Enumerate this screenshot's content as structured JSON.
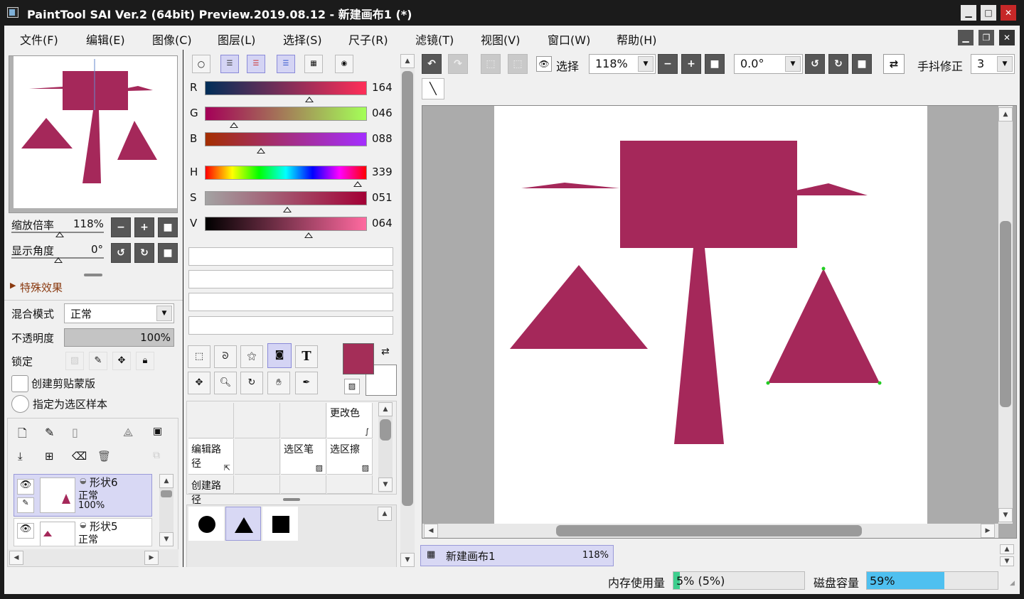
{
  "window": {
    "title": "PaintTool SAI Ver.2 (64bit) Preview.2019.08.12 - 新建画布1 (*)"
  },
  "menu": [
    "文件(F)",
    "编辑(E)",
    "图像(C)",
    "图层(L)",
    "选择(S)",
    "尺子(R)",
    "滤镜(T)",
    "视图(V)",
    "窗口(W)",
    "帮助(H)"
  ],
  "navigator": {
    "zoom_label": "缩放倍率",
    "zoom_value": "118%",
    "angle_label": "显示角度",
    "angle_value": "0°"
  },
  "effects": {
    "label": "特殊效果"
  },
  "layer_props": {
    "blend_label": "混合模式",
    "blend_value": "正常",
    "opacity_label": "不透明度",
    "opacity_value": "100%",
    "opacity": 1.0,
    "lock_label": "锁定",
    "clip_label": "创建剪贴蒙版",
    "sample_label": "指定为选区样本"
  },
  "layers": [
    {
      "name": "形状6",
      "mode": "正常",
      "opacity": "100%"
    },
    {
      "name": "形状5",
      "mode": "正常",
      "opacity": ""
    }
  ],
  "color": {
    "sliders": [
      {
        "label": "R",
        "value": "164",
        "level": 0.643
      },
      {
        "label": "G",
        "value": "046",
        "level": 0.18
      },
      {
        "label": "B",
        "value": "088",
        "level": 0.345
      },
      {
        "label": "H",
        "value": "339",
        "level": 0.942
      },
      {
        "label": "S",
        "value": "051",
        "level": 0.51
      },
      {
        "label": "V",
        "value": "064",
        "level": 0.64
      }
    ],
    "primary": "#a42e58",
    "secondary": "#ffffff"
  },
  "tool_palette": {
    "change_color": "更改色",
    "edit_path": "编辑路径",
    "select_pen": "选区笔",
    "select_eraser": "选区擦",
    "create_path": "创建路径"
  },
  "canvas_toolbar": {
    "select_label": "选择",
    "zoom": "118%",
    "angle": "0.0°",
    "stabilizer_label": "手抖修正",
    "stabilizer": "3"
  },
  "canvas_tab": {
    "name": "新建画布1",
    "zoom": "118%"
  },
  "status": {
    "memory_label": "内存使用量",
    "memory_value": "5% (5%)",
    "memory_level": 0.05,
    "disk_label": "磁盘容量",
    "disk_value": "59%",
    "disk_level": 0.59
  }
}
